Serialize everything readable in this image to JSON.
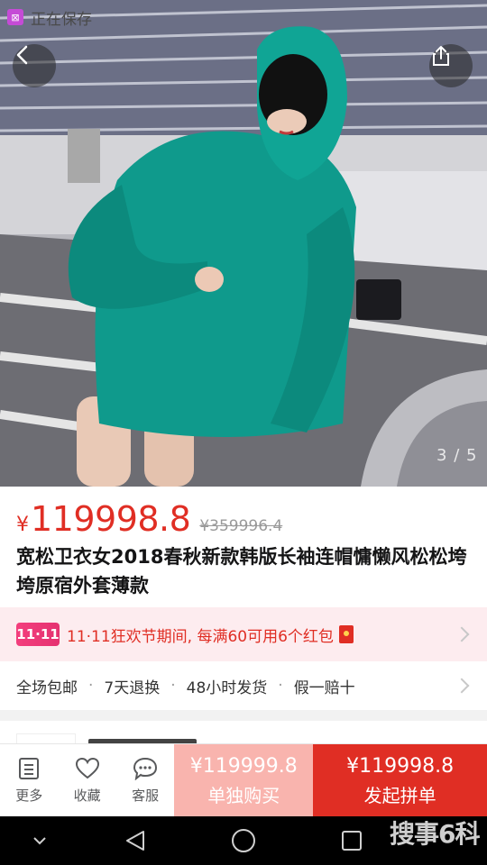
{
  "status_toast": {
    "text": "正在保存"
  },
  "gallery": {
    "current": "3",
    "separator": "/",
    "total": "5"
  },
  "product": {
    "currency": "¥",
    "price": "119998.8",
    "original_price": "¥359996.4",
    "title": "宽松卫衣女2018春秋新款韩版长袖连帽慵懒风松松垮垮原宿外套薄款"
  },
  "promo": {
    "badge": "11·11",
    "text": "11·11狂欢节期间, 每满60可用6个红包"
  },
  "services": [
    "全场包邮",
    "7天退换",
    "48小时发货",
    "假一赔十"
  ],
  "services_separator": "·",
  "bottom_bar": {
    "tools": [
      {
        "label": "更多",
        "icon": "menu-icon"
      },
      {
        "label": "收藏",
        "icon": "heart-icon"
      },
      {
        "label": "客服",
        "icon": "chat-icon"
      }
    ],
    "single_buy": {
      "price": "¥119999.8",
      "label": "单独购买"
    },
    "group_buy": {
      "price": "¥119998.8",
      "label": "发起拼单"
    }
  },
  "watermark": {
    "text": "搜事6科"
  },
  "colors": {
    "accent": "#e02e24",
    "single_buy_bg": "#f9b4ae",
    "promo_bg": "#fdecef",
    "hoodie": "#0f9a8c"
  }
}
